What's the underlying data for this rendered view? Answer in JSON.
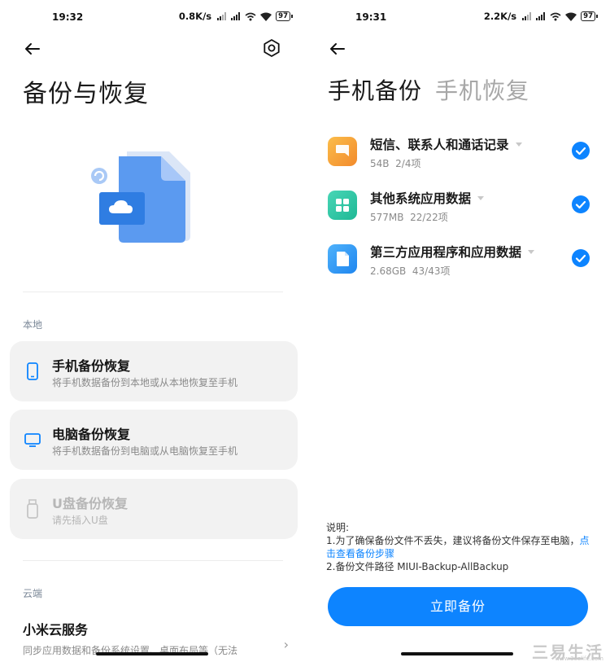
{
  "left": {
    "status": {
      "time": "19:32",
      "speed": "0.8K/s",
      "battery": "97"
    },
    "title": "备份与恢复",
    "section_local": "本地",
    "cards": [
      {
        "title": "手机备份恢复",
        "subtitle": "将手机数据备份到本地或从本地恢复至手机",
        "icon": "phone-icon",
        "enabled": true
      },
      {
        "title": "电脑备份恢复",
        "subtitle": "将手机数据备份到电脑或从电脑恢复至手机",
        "icon": "monitor-icon",
        "enabled": true
      },
      {
        "title": "U盘备份恢复",
        "subtitle": "请先插入U盘",
        "icon": "usb-drive-icon",
        "enabled": false
      }
    ],
    "section_cloud": "云端",
    "cloud": {
      "title": "小米云服务",
      "subtitle": "同步应用数据和备份系统设置、桌面布局等（无法"
    },
    "colors": {
      "accent": "#0d84ff",
      "card_bg": "#f2f2f2"
    }
  },
  "right": {
    "status": {
      "time": "19:31",
      "speed": "2.2K/s",
      "battery": "97"
    },
    "tabs": [
      {
        "label": "手机备份",
        "active": true
      },
      {
        "label": "手机恢复",
        "active": false
      }
    ],
    "items": [
      {
        "name": "短信、联系人和通话记录",
        "size": "54B",
        "count": "2/4项",
        "icon": "message-icon",
        "color": "#f7a23a",
        "checked": true
      },
      {
        "name": "其他系统应用数据",
        "size": "577MB",
        "count": "22/22项",
        "icon": "apps-grid-icon",
        "color": "#34c7a8",
        "checked": true
      },
      {
        "name": "第三方应用程序和应用数据",
        "size": "2.68GB",
        "count": "43/43项",
        "icon": "document-icon",
        "color": "#2f9bf5",
        "checked": true
      }
    ],
    "note": {
      "heading": "说明:",
      "line1_prefix": "1.为了确保备份文件不丢失，建议将备份文件保存至电脑，",
      "line1_link": "点击查看备份步骤",
      "line2": "2.备份文件路径 MIUI-Backup-AllBackup"
    },
    "button": "立即备份",
    "watermark": {
      "text": "三易生活",
      "url": "www.3eelife.com"
    }
  }
}
